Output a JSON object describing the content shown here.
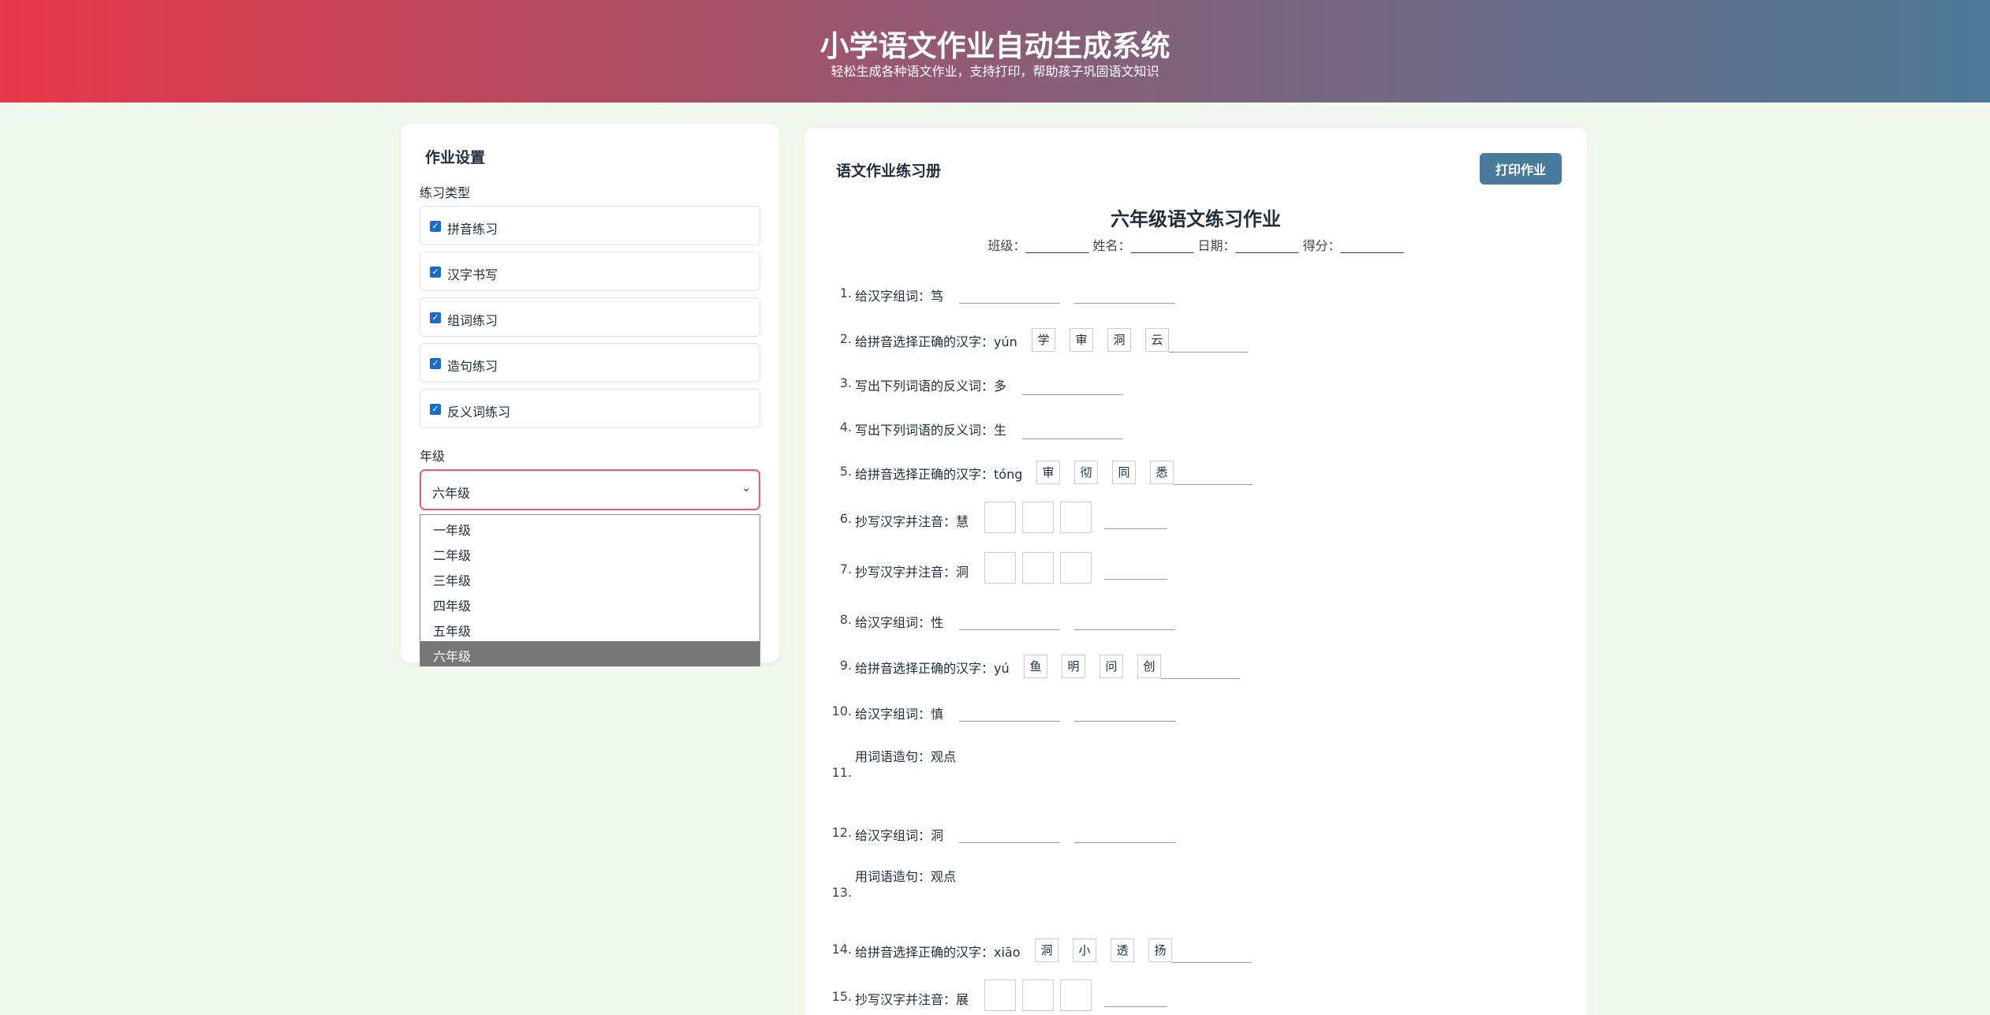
{
  "header": {
    "title": "小学语文作业自动生成系统",
    "subtitle": "轻松生成各种语文作业，支持打印，帮助孩子巩固语文知识"
  },
  "settings": {
    "title": "作业设置",
    "types_label": "练习类型",
    "types": [
      {
        "label": "拼音练习",
        "checked": true
      },
      {
        "label": "汉字书写",
        "checked": true
      },
      {
        "label": "组词练习",
        "checked": true
      },
      {
        "label": "造句练习",
        "checked": true
      },
      {
        "label": "反义词练习",
        "checked": true
      }
    ],
    "grade_label": "年级",
    "grade_selected": "六年级",
    "grade_options": [
      "一年级",
      "二年级",
      "三年级",
      "四年级",
      "五年级",
      "六年级"
    ]
  },
  "workbook": {
    "panel_title": "语文作业练习册",
    "print_label": "打印作业",
    "sheet_title": "六年级语文练习作业",
    "info": "班级：__________ 姓名：__________ 日期：__________ 得分：__________",
    "questions": [
      {
        "num": "1.",
        "prompt": "给汉字组词：笃"
      },
      {
        "num": "2.",
        "prompt": "给拼音选择正确的汉字：yún",
        "options": [
          "学",
          "审",
          "洞",
          "云"
        ]
      },
      {
        "num": "3.",
        "prompt": "写出下列词语的反义词：多"
      },
      {
        "num": "4.",
        "prompt": "写出下列词语的反义词：生"
      },
      {
        "num": "5.",
        "prompt": "给拼音选择正确的汉字：tóng",
        "options": [
          "审",
          "彻",
          "同",
          "悉"
        ]
      },
      {
        "num": "6.",
        "prompt": "抄写汉字并注音：慧"
      },
      {
        "num": "7.",
        "prompt": "抄写汉字并注音：洞"
      },
      {
        "num": "8.",
        "prompt": "给汉字组词：性"
      },
      {
        "num": "9.",
        "prompt": "给拼音选择正确的汉字：yú",
        "options": [
          "鱼",
          "明",
          "问",
          "创"
        ]
      },
      {
        "num": "10.",
        "prompt": "给汉字组词：慎"
      },
      {
        "num": "11.",
        "prompt": "用词语造句：观点"
      },
      {
        "num": "12.",
        "prompt": "给汉字组词：洞"
      },
      {
        "num": "13.",
        "prompt": "用词语造句：观点"
      },
      {
        "num": "14.",
        "prompt": "给拼音选择正确的汉字：xiāo",
        "options": [
          "洞",
          "小",
          "透",
          "扬"
        ]
      },
      {
        "num": "15.",
        "prompt": "抄写汉字并注音：展"
      }
    ]
  }
}
